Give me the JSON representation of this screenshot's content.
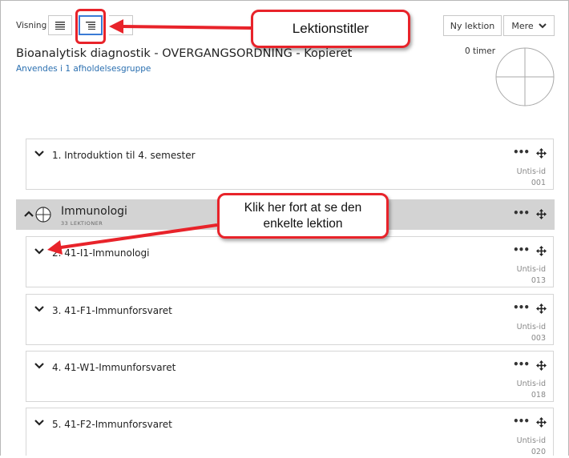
{
  "toolbar": {
    "view_label": "Visning",
    "new_lesson_label": "Ny lektion",
    "more_label": "Mere"
  },
  "course": {
    "title": "Bioanalytisk diagnostik - OVERGANGSORDNING - Kopieret",
    "link": "Anvendes i 1 afholdelsesgruppe",
    "hours": "0 timer"
  },
  "lessons": [
    {
      "title": "1. Introduktion til 4. semester",
      "untis_label": "Untis-id",
      "untis_id": "001"
    },
    {
      "title": "2. 41-I1-Immunologi",
      "untis_label": "Untis-id",
      "untis_id": "013"
    },
    {
      "title": "3. 41-F1-Immunforsvaret",
      "untis_label": "Untis-id",
      "untis_id": "003"
    },
    {
      "title": "4. 41-W1-Immunforsvaret",
      "untis_label": "Untis-id",
      "untis_id": "018"
    },
    {
      "title": "5. 41-F2-Immunforsvaret",
      "untis_label": "Untis-id",
      "untis_id": "020"
    }
  ],
  "group": {
    "title": "Immunologi",
    "count": "33 LEKTIONER"
  },
  "annotations": {
    "callout_titles": "Lektionstitler",
    "callout_click": "Klik her fort at se den enkelte lektion"
  },
  "colors": {
    "annotation_red": "#e8232a",
    "link_blue": "#2a6fb0",
    "group_bg": "#d3d3d3"
  }
}
